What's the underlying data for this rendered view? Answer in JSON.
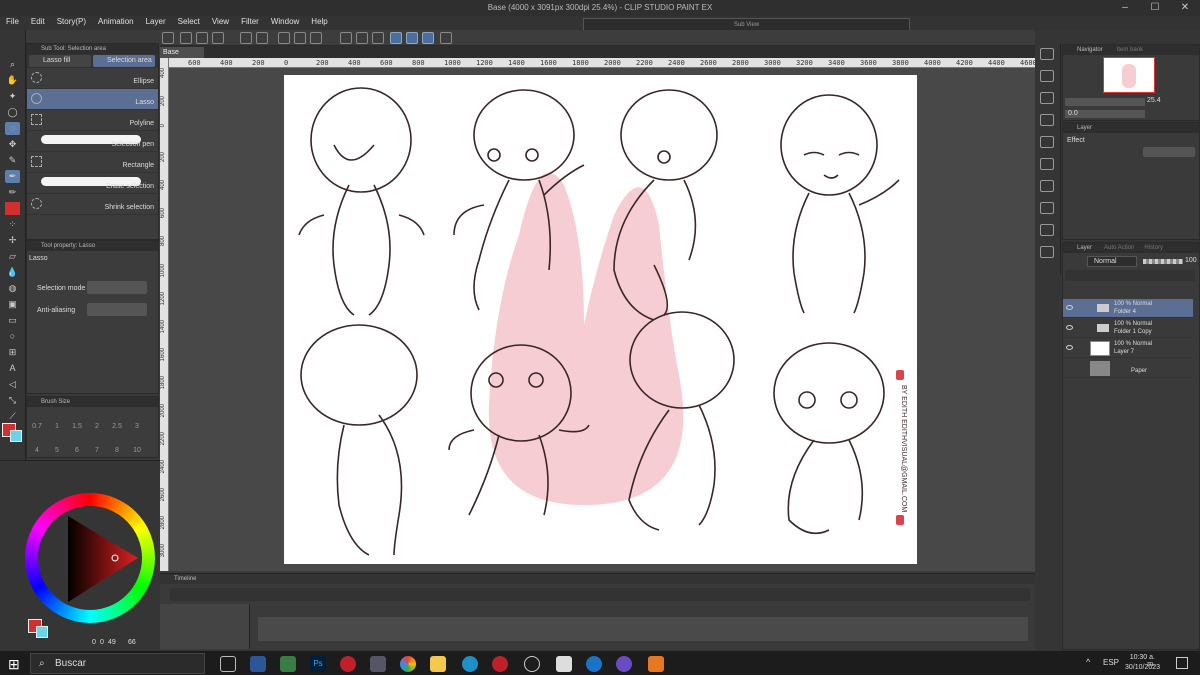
{
  "app": {
    "title": "Base (4000 x 3091px 300dpi 25.4%) - CLIP STUDIO PAINT EX",
    "subview": "Sub View"
  },
  "menu": [
    "File",
    "Edit",
    "Story(P)",
    "Animation",
    "Layer",
    "Select",
    "View",
    "Filter",
    "Window",
    "Help"
  ],
  "document": {
    "tab": "Base"
  },
  "subtool": {
    "header": "Sub Tool: Selection area",
    "tabs": [
      "Lasso fill",
      "Selection area"
    ],
    "items": [
      "Ellipse",
      "Lasso",
      "Polyline",
      "Selection pen",
      "Rectangle",
      "Erase selection",
      "Shrink selection"
    ],
    "selected": "Lasso"
  },
  "toolprop": {
    "header": "Tool property: Lasso",
    "name": "Lasso",
    "mode_label": "Selection mode",
    "aa_label": "Anti-aliasing"
  },
  "brushsize": {
    "header": "Brush Size",
    "values": [
      "0.7",
      "1",
      "1.5",
      "2",
      "2.5",
      "3",
      "4",
      "5",
      "6",
      "7",
      "8",
      "10"
    ]
  },
  "color": {
    "main": "#d32f2f",
    "sub": "#6ad4ea",
    "readout": [
      "0",
      "0",
      "49",
      "66"
    ]
  },
  "ruler": {
    "h": [
      "600",
      "400",
      "200",
      "0",
      "200",
      "400",
      "600",
      "800",
      "1000",
      "1200",
      "1400",
      "1600",
      "1800",
      "2000",
      "2200",
      "2400",
      "2600",
      "2800",
      "3000",
      "3200",
      "3400",
      "3600",
      "3800",
      "4000",
      "4200",
      "4400",
      "4600"
    ],
    "v": [
      "400",
      "200",
      "0",
      "200",
      "400",
      "600",
      "800",
      "1000",
      "1200",
      "1400",
      "1600",
      "1800",
      "2000",
      "2200",
      "2400",
      "2600",
      "2800",
      "3000"
    ]
  },
  "canvas": {
    "credit": "BY EDITH  EDITHVISUAL@GMAIL.COM"
  },
  "timeline": {
    "header": "Timeline"
  },
  "navigator": {
    "tabs": [
      "Navigator",
      "Item bank"
    ],
    "zoom": "25.4",
    "rotate": "0.0"
  },
  "effect": {
    "tabs": [
      "Layer"
    ],
    "label": "Effect"
  },
  "layers": {
    "tabs": [
      "Layer",
      "Auto Action",
      "History"
    ],
    "blend": "Normal",
    "opacity": "100",
    "items": [
      {
        "l1": "100 % Normal",
        "l2": "Folder 4",
        "selected": true
      },
      {
        "l1": "100 % Normal",
        "l2": "Folder 1 Copy",
        "selected": false
      },
      {
        "l1": "100 % Normal",
        "l2": "Layer 7",
        "selected": false
      },
      {
        "l1": "",
        "l2": "Paper",
        "selected": false
      }
    ]
  },
  "taskbar": {
    "search": "Buscar",
    "lang": "ESP",
    "time": "10:30 a. m.",
    "date": "30/10/2023"
  }
}
